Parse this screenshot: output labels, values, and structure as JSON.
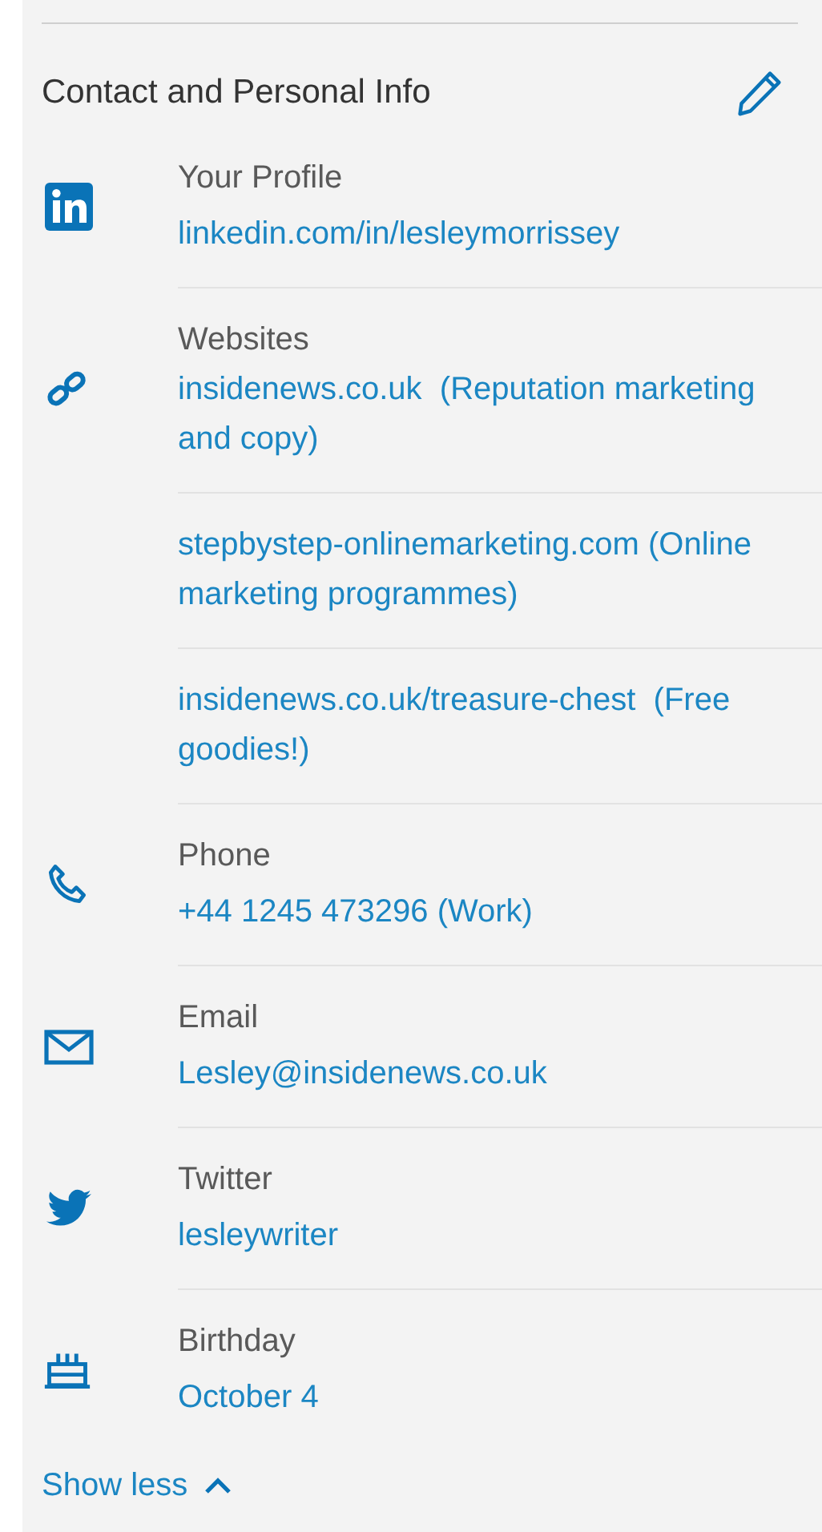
{
  "title": "Contact and Personal Info",
  "sections": [
    {
      "kind": "profile",
      "label": "Your Profile",
      "entries": [
        "linkedin.com/in/lesleymorrissey"
      ]
    },
    {
      "kind": "websites",
      "label": "Websites",
      "entries": [
        "insidenews.co.uk  (Reputation marketing and copy)",
        "stepbystep-onlinemarketing.com (Online marketing programmes)",
        "insidenews.co.uk/treasure-chest  (Free goodies!)"
      ]
    },
    {
      "kind": "phone",
      "label": "Phone",
      "entries": [
        "+44 1245 473296 (Work)"
      ]
    },
    {
      "kind": "email",
      "label": "Email",
      "entries": [
        "Lesley@insidenews.co.uk"
      ]
    },
    {
      "kind": "twitter",
      "label": "Twitter",
      "entries": [
        "lesleywriter"
      ]
    },
    {
      "kind": "birthday",
      "label": "Birthday",
      "entries": [
        "October 4"
      ]
    }
  ],
  "toggle": {
    "label": "Show less",
    "expanded": true
  }
}
